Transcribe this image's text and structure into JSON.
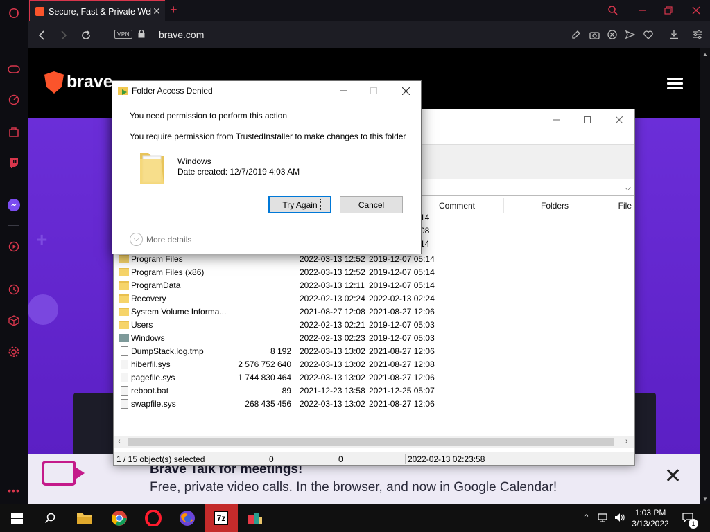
{
  "browser": {
    "tab_title": "Secure, Fast & Private Web",
    "url": "brave.com",
    "vpn_label": "VPN",
    "new_tab_symbol": "+",
    "close_symbol": "✕"
  },
  "opera_sidebar": {
    "icons": [
      "opera-logo-icon",
      "gamepad-icon",
      "speed-dial-icon",
      "shopping-icon",
      "twitch-icon",
      "messenger-icon",
      "player-icon",
      "history-icon",
      "cube-icon",
      "settings-icon",
      "more-icon"
    ]
  },
  "page": {
    "brand": "brave",
    "banner_title": "Brave Talk for meetings!",
    "banner_subtitle": "Free, private video calls. In the browser, and now in Google Calendar!",
    "banner_close": "✕"
  },
  "file_manager": {
    "columns": [
      "Comment",
      "Folders",
      "File"
    ],
    "rows": [
      {
        "type": "folder",
        "name": "Program Files",
        "size": "",
        "modified": "2022-03-13 12:52",
        "created": "2019-12-07 05:14"
      },
      {
        "type": "folder",
        "name": "Program Files (x86)",
        "size": "",
        "modified": "2022-03-13 12:52",
        "created": "2019-12-07 05:14"
      },
      {
        "type": "folder",
        "name": "ProgramData",
        "size": "",
        "modified": "2022-03-13 12:11",
        "created": "2019-12-07 05:14"
      },
      {
        "type": "folder",
        "name": "Recovery",
        "size": "",
        "modified": "2022-02-13 02:24",
        "created": "2022-02-13 02:24"
      },
      {
        "type": "folder",
        "name": "System Volume Informa...",
        "size": "",
        "modified": "2021-08-27 12:08",
        "created": "2021-08-27 12:06"
      },
      {
        "type": "folder",
        "name": "Users",
        "size": "",
        "modified": "2022-02-13 02:21",
        "created": "2019-12-07 05:03"
      },
      {
        "type": "folder-win",
        "name": "Windows",
        "size": "",
        "modified": "2022-02-13 02:23",
        "created": "2019-12-07 05:03"
      },
      {
        "type": "file",
        "name": "DumpStack.log.tmp",
        "size": "8 192",
        "modified": "2022-03-13 13:02",
        "created": "2021-08-27 12:06"
      },
      {
        "type": "sysfile",
        "name": "hiberfil.sys",
        "size": "2 576 752 640",
        "modified": "2022-03-13 13:02",
        "created": "2021-08-27 12:08"
      },
      {
        "type": "sysfile",
        "name": "pagefile.sys",
        "size": "1 744 830 464",
        "modified": "2022-03-13 13:02",
        "created": "2021-08-27 12:06"
      },
      {
        "type": "sysfile",
        "name": "reboot.bat",
        "size": "89",
        "modified": "2021-12-23 13:58",
        "created": "2021-12-25 05:07"
      },
      {
        "type": "sysfile",
        "name": "swapfile.sys",
        "size": "268 435 456",
        "modified": "2022-03-13 13:02",
        "created": "2021-08-27 12:06"
      }
    ],
    "hidden_row_fragments": [
      "14",
      "08",
      "14"
    ],
    "status": {
      "selected": "1 / 15 object(s) selected",
      "size1": "0",
      "size2": "0",
      "date": "2022-02-13 02:23:58"
    }
  },
  "dialog": {
    "title": "Folder Access Denied",
    "message1": "You need permission to perform this action",
    "message2": "You require permission from TrustedInstaller to make changes to this folder",
    "folder_name": "Windows",
    "folder_date": "Date created: 12/7/2019 4:03 AM",
    "try_again": "Try Again",
    "cancel": "Cancel",
    "more_details": "More details"
  },
  "taskbar": {
    "time": "1:03 PM",
    "date": "3/13/2022",
    "notification_count": "1",
    "apps": [
      "file-explorer-icon",
      "chrome-icon",
      "opera-icon",
      "firefox-icon",
      "7zip-icon",
      "app-icon"
    ]
  }
}
